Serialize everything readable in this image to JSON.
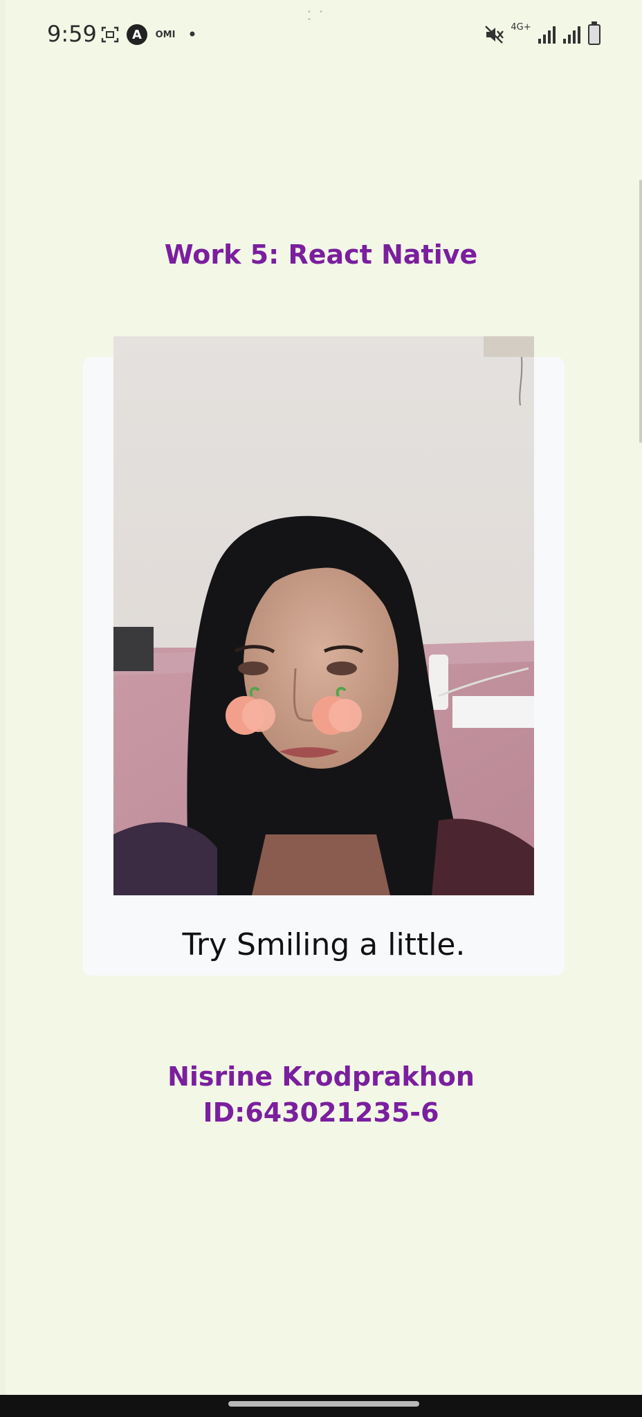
{
  "status_bar": {
    "time": "9:59",
    "icons": [
      "screenshot-icon",
      "app-a-icon",
      "omi-icon",
      "notification-dot-icon",
      "mute-icon",
      "network-4g-icon",
      "signal-icon",
      "signal-icon",
      "battery-icon"
    ],
    "omi_label": "OMI",
    "network_label": "4G+",
    "app_letter": "A"
  },
  "header": {
    "title": "Work 5: React Native"
  },
  "camera_card": {
    "caption": "Try Smiling a little.",
    "overlay": "peach-cheek-filter"
  },
  "footer": {
    "name": "Nisrine Krodprakhon",
    "student_id": "ID:643021235-6"
  },
  "colors": {
    "background": "#f3f7e6",
    "accent": "#7a1f9e",
    "card": "#f8f9fb"
  }
}
